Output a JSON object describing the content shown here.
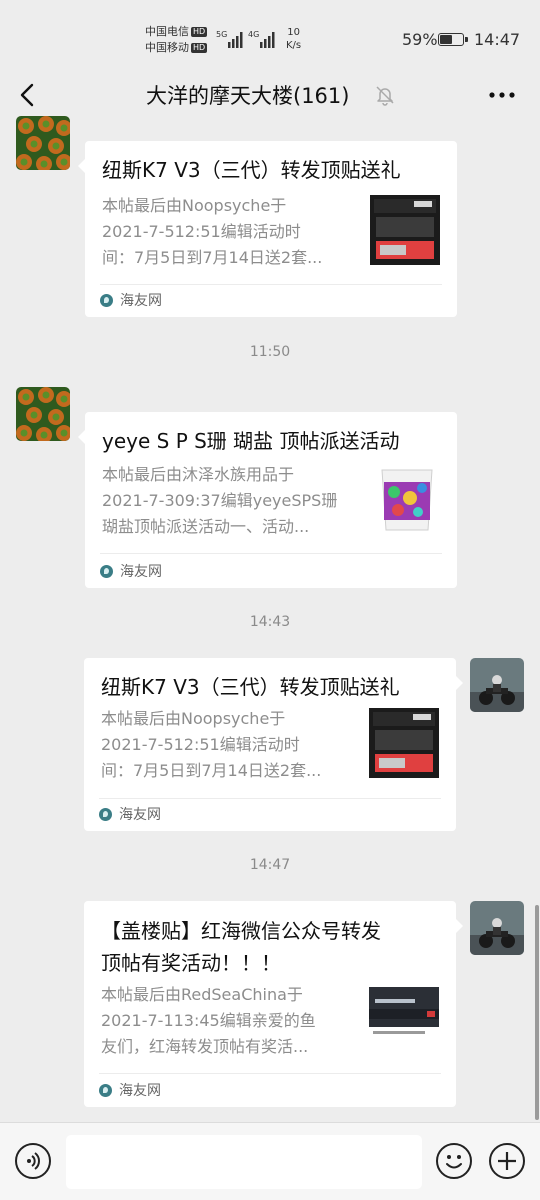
{
  "status_bar": {
    "carrier_1": "中国电信",
    "carrier_2": "中国移动",
    "hd_badge": "HD",
    "network_1": "5G",
    "network_2": "4G",
    "speed_value": "10",
    "speed_unit": "K/s",
    "battery_percent": "59%",
    "battery_level": 0.59,
    "time": "14:47"
  },
  "nav": {
    "title": "大洋的摩天大楼(161)",
    "muted": true
  },
  "messages": [
    {
      "sender": "other",
      "title": "纽斯K7 V3（三代）转发顶贴送礼",
      "desc": [
        "本帖最后由Noopsyche于",
        "2021-7-512:51编辑活动时",
        "间：7月5日到7月14日送2套..."
      ],
      "source": "海友网",
      "thumb": "k7-product-thumbnail"
    },
    {
      "time": "11:50"
    },
    {
      "sender": "other",
      "title": "yeye S P S珊 瑚盐 顶帖派送活动",
      "desc": [
        "本帖最后由沐泽水族用品于",
        "2021-7-309:37编辑yeyeSPS珊",
        "瑚盐顶帖派送活动一、活动..."
      ],
      "source": "海友网",
      "thumb": "coral-salt-bucket-thumbnail"
    },
    {
      "time": "14:43"
    },
    {
      "sender": "self",
      "title": "纽斯K7 V3（三代）转发顶贴送礼",
      "desc": [
        "本帖最后由Noopsyche于",
        "2021-7-512:51编辑活动时",
        "间：7月5日到7月14日送2套..."
      ],
      "source": "海友网",
      "thumb": "k7-product-thumbnail"
    },
    {
      "time": "14:47"
    },
    {
      "sender": "self",
      "title_lines": [
        "【盖楼贴】红海微信公众号转发",
        "顶帖有奖活动！！！"
      ],
      "desc": [
        "本帖最后由RedSeaChina于",
        "2021-7-113:45编辑亲爱的鱼",
        "友们，红海转发顶帖有奖活..."
      ],
      "source": "海友网",
      "thumb": "redsea-promo-thumbnail"
    }
  ],
  "input": {
    "value": "",
    "placeholder": ""
  },
  "colors": {
    "background": "#ededed",
    "card": "#ffffff",
    "timestamp": "#8a8a8a",
    "source_icon": "#3a7d86"
  }
}
